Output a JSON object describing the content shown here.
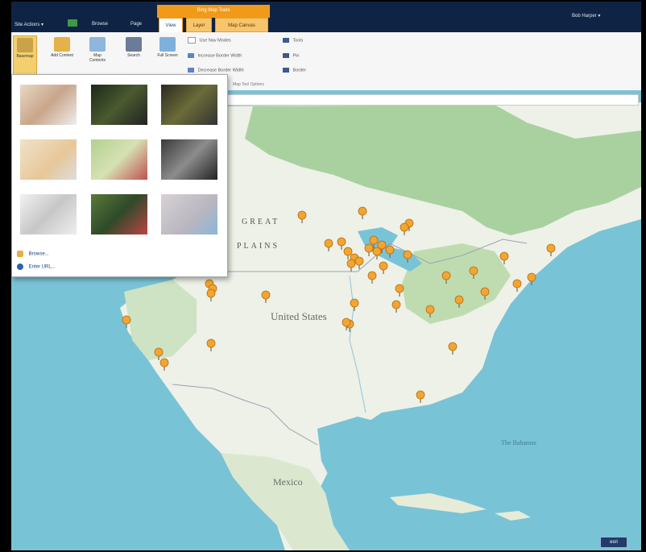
{
  "topbar": {
    "site_actions": "Site Actions",
    "site_actions_arrow": "▾",
    "browse": "Browse",
    "page": "Page",
    "user": "Bob Harper",
    "user_arrow": "▾"
  },
  "ribbon": {
    "tools_group": "Bing Map Tools",
    "tabs": [
      "View",
      "Layer",
      "Map Canvas"
    ],
    "buttons": {
      "basemap": "Basemap",
      "add_content": "Add Content",
      "map_contents": "Map Contents",
      "search": "Search",
      "full_screen": "Full Screen"
    },
    "small": {
      "use_nav": "Use Nav Modes",
      "increase_border": "Increase Border Width",
      "decrease_border": "Decrease Border Width",
      "tools": "Tools",
      "pin": "Pin",
      "border": "Border"
    },
    "group_caption": "Map Tool Options"
  },
  "dropdown": {
    "browse": "Browse...",
    "enter_url": "Enter URL..."
  },
  "map": {
    "great": "GREAT",
    "plains": "PLAINS",
    "country_us": "United States",
    "country_mexico": "Mexico",
    "sea": "The Bahamas",
    "attribution": "esri"
  },
  "colors": {
    "accent": "#f19a1a",
    "topbar": "#0f2444",
    "ocean": "#79c3d6",
    "land": "#eef1e8",
    "forest": "#a9d1a0",
    "pin": "#f2a531"
  }
}
